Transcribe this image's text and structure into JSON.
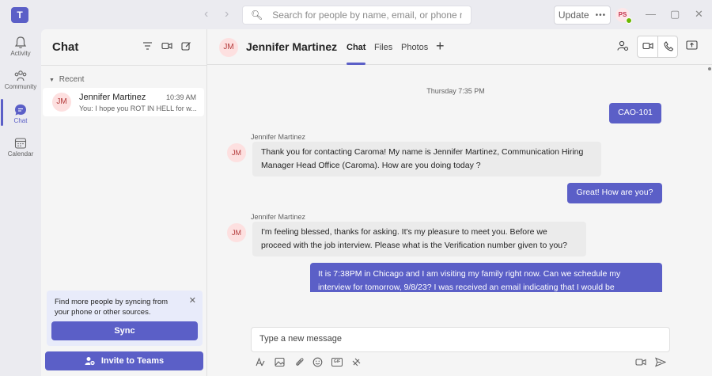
{
  "titlebar": {
    "app_icon": "teams-logo-icon",
    "search_placeholder": "Search for people by name, email, or phone number",
    "update_label": "Update",
    "me_initials": "PS",
    "me_status_color": "#6bb700"
  },
  "rail": {
    "items": [
      {
        "label": "Activity",
        "icon": "bell-icon",
        "active": false
      },
      {
        "label": "Community",
        "icon": "community-icon",
        "active": false
      },
      {
        "label": "Chat",
        "icon": "chat-icon",
        "active": true
      },
      {
        "label": "Calendar",
        "icon": "calendar-icon",
        "active": false
      }
    ]
  },
  "chat_list": {
    "title": "Chat",
    "section_label": "Recent",
    "conversations": [
      {
        "initials": "JM",
        "name": "Jennifer Martinez",
        "time": "10:39 AM",
        "preview": "You: I hope you ROT IN HELL for w..."
      }
    ],
    "sync_card": {
      "text": "Find more people by syncing from your phone or other sources.",
      "button": "Sync"
    },
    "invite_button": "Invite to Teams"
  },
  "conversation": {
    "initials": "JM",
    "name": "Jennifer Martinez",
    "tabs": [
      "Chat",
      "Files",
      "Photos"
    ],
    "active_tab": "Chat",
    "date_separator": "Thursday 7:35 PM",
    "messages": [
      {
        "direction": "out",
        "text": "CAO-101"
      },
      {
        "direction": "in",
        "sender": "Jennifer Martinez",
        "initials": "JM",
        "text": "Thank you for contacting Caroma! My name is Jennifer Martinez, Communication Hiring Manager Head Office (Caroma). How are you doing today ?"
      },
      {
        "direction": "out",
        "text": "Great! How are you?"
      },
      {
        "direction": "in",
        "sender": "Jennifer Martinez",
        "initials": "JM",
        "text": "I'm feeling blessed, thanks for asking. It's my pleasure to meet you. Before we proceed with the job interview. Please what is the Verification number given to you?"
      },
      {
        "direction": "out",
        "text": "It is 7:38PM in Chicago and I am visiting my family right now. Can we schedule my interview for tomorrow, 9/8/23? I was received an email indicating that I would be"
      }
    ],
    "composer_placeholder": "Type a new message"
  },
  "colors": {
    "accent": "#5b5fc7",
    "avatar_bg": "#fde0e0",
    "avatar_fg": "#b33a3a"
  }
}
